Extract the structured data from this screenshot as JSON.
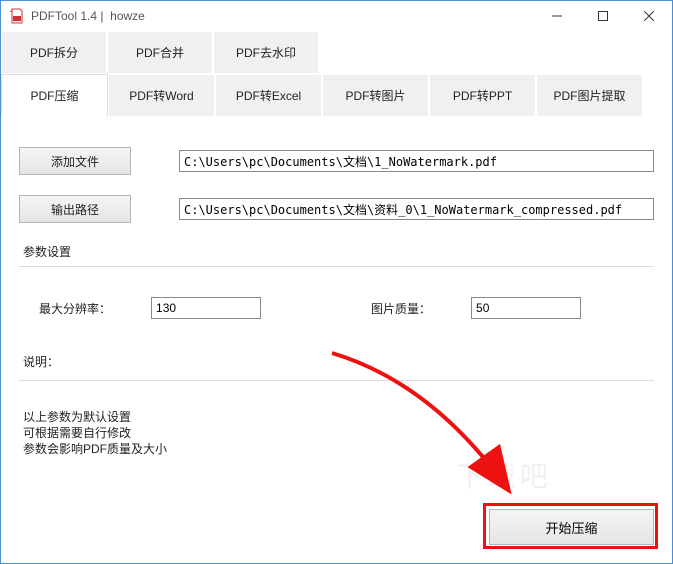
{
  "window": {
    "title": "PDFTool 1.4 |  howze"
  },
  "tabs_row1": [
    {
      "label": "PDF拆分"
    },
    {
      "label": "PDF合并"
    },
    {
      "label": "PDF去水印"
    }
  ],
  "tabs_row2": [
    {
      "label": "PDF压缩",
      "active": true
    },
    {
      "label": "PDF转Word"
    },
    {
      "label": "PDF转Excel"
    },
    {
      "label": "PDF转图片"
    },
    {
      "label": "PDF转PPT"
    },
    {
      "label": "PDF图片提取"
    }
  ],
  "buttons": {
    "add_file": "添加文件",
    "output_path": "输出路径",
    "start": "开始压缩"
  },
  "paths": {
    "input": "C:\\Users\\pc\\Documents\\文档\\1_NoWatermark.pdf",
    "output": "C:\\Users\\pc\\Documents\\文档\\资料_0\\1_NoWatermark_compressed.pdf"
  },
  "params": {
    "section_label": "参数设置",
    "max_res_label": "最大分辨率：",
    "max_res_value": "130",
    "quality_label": "图片质量：",
    "quality_value": "50"
  },
  "desc": {
    "section_label": "说明：",
    "text": "以上参数为默认设置\n可根据需要自行修改\n参数会影响PDF质量及大小"
  },
  "watermark": "下载吧"
}
